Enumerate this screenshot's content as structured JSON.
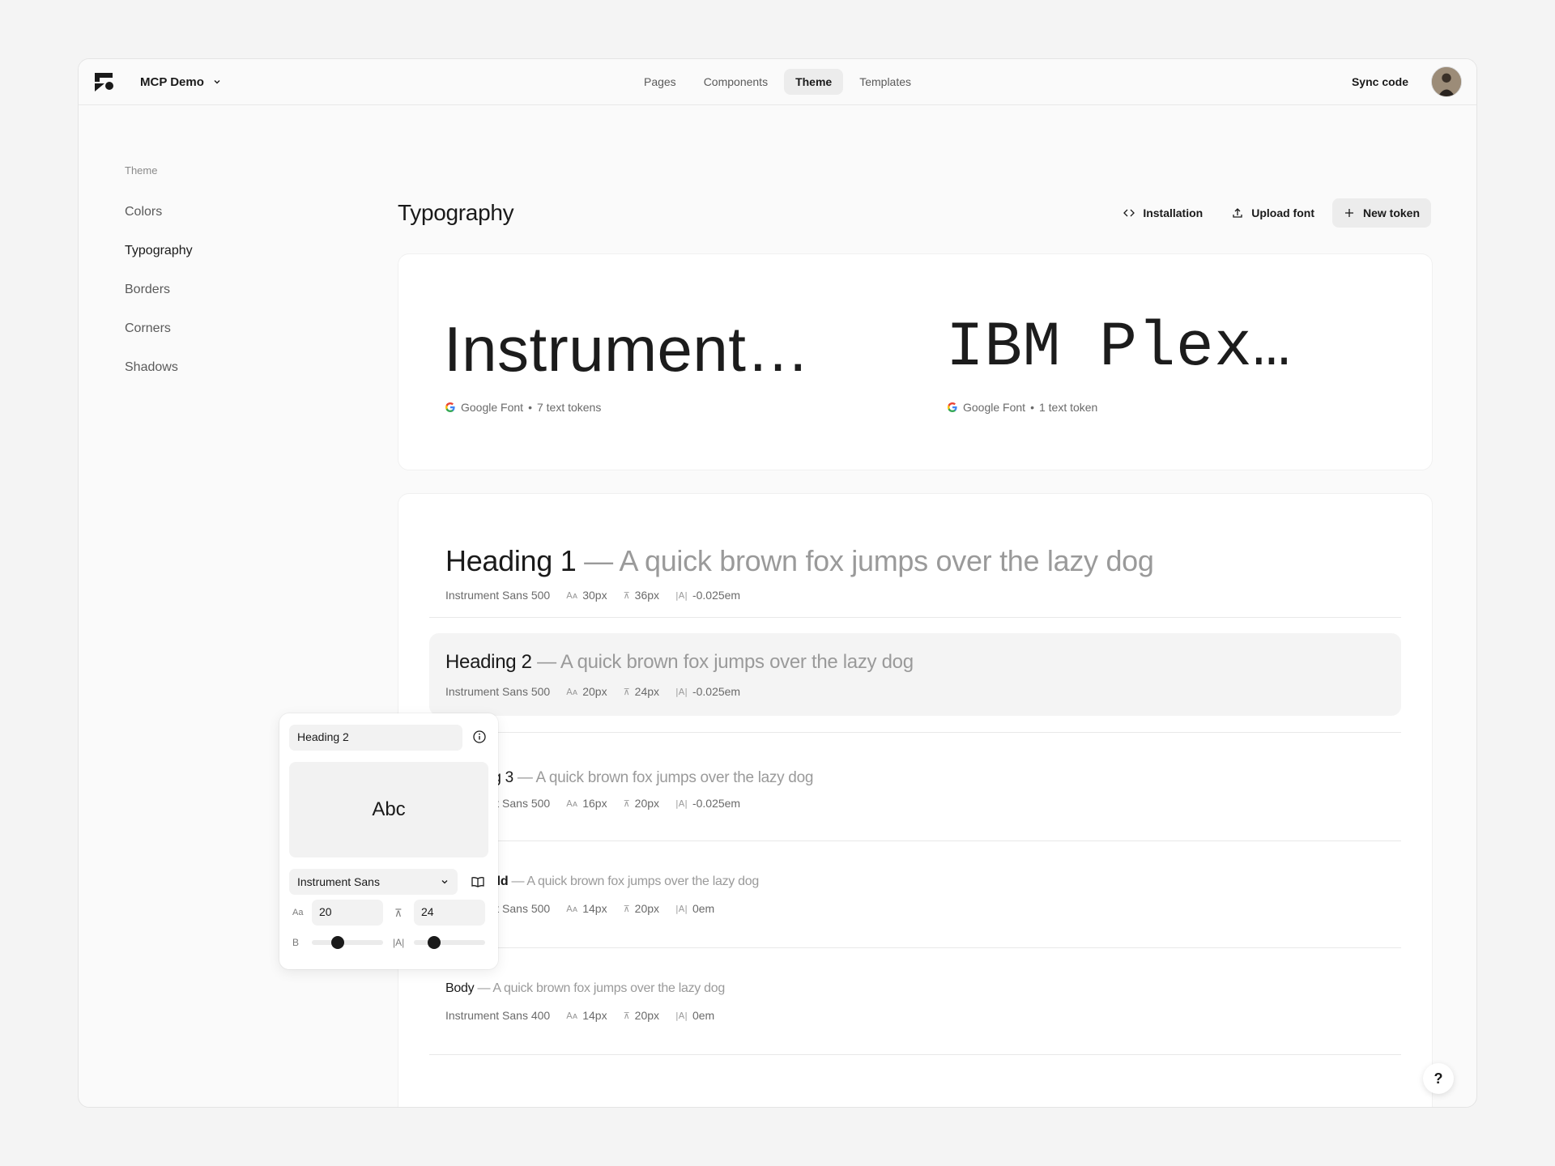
{
  "header": {
    "project_name": "MCP Demo",
    "nav": [
      "Pages",
      "Components",
      "Theme",
      "Templates"
    ],
    "active_nav": "Theme",
    "sync_label": "Sync code"
  },
  "sidebar": {
    "heading": "Theme",
    "items": [
      "Colors",
      "Typography",
      "Borders",
      "Corners",
      "Shadows"
    ],
    "active": "Typography"
  },
  "main": {
    "title": "Typography",
    "actions": {
      "installation": "Installation",
      "upload": "Upload font",
      "new_token": "New token"
    },
    "fonts": [
      {
        "display": "Instrument…",
        "source": "Google Font",
        "tokens": "7 text tokens"
      },
      {
        "display": "IBM Plex…",
        "source": "Google Font",
        "tokens": "1 text token"
      }
    ],
    "sample_text": "— A quick brown fox jumps over the lazy dog",
    "tokens": [
      {
        "name": "Heading 1",
        "font": "Instrument Sans 500",
        "size": "30px",
        "line": "36px",
        "tracking": "-0.025em"
      },
      {
        "name": "Heading 2",
        "font": "Instrument Sans 500",
        "size": "20px",
        "line": "24px",
        "tracking": "-0.025em"
      },
      {
        "name": "Heading 3",
        "font": "Instrument Sans 500",
        "size": "16px",
        "line": "20px",
        "tracking": "-0.025em"
      },
      {
        "name": "Body Bold",
        "font": "Instrument Sans 500",
        "size": "14px",
        "line": "20px",
        "tracking": "0em"
      },
      {
        "name": "Body",
        "font": "Instrument Sans 400",
        "size": "14px",
        "line": "20px",
        "tracking": "0em"
      }
    ]
  },
  "editor": {
    "token_name": "Heading 2",
    "preview": "Abc",
    "font_family": "Instrument Sans",
    "size_label": "Aa",
    "size_value": "20",
    "line_value": "24",
    "weight_label": "B",
    "tracking_label": "|A|",
    "weight_level": 0.36,
    "tracking_level": 0.28
  },
  "help_label": "?",
  "colors": {
    "accent": "#1a1a1a",
    "muted": "#9a9a9a",
    "surface": "#ffffff",
    "bg": "#f4f4f4"
  }
}
